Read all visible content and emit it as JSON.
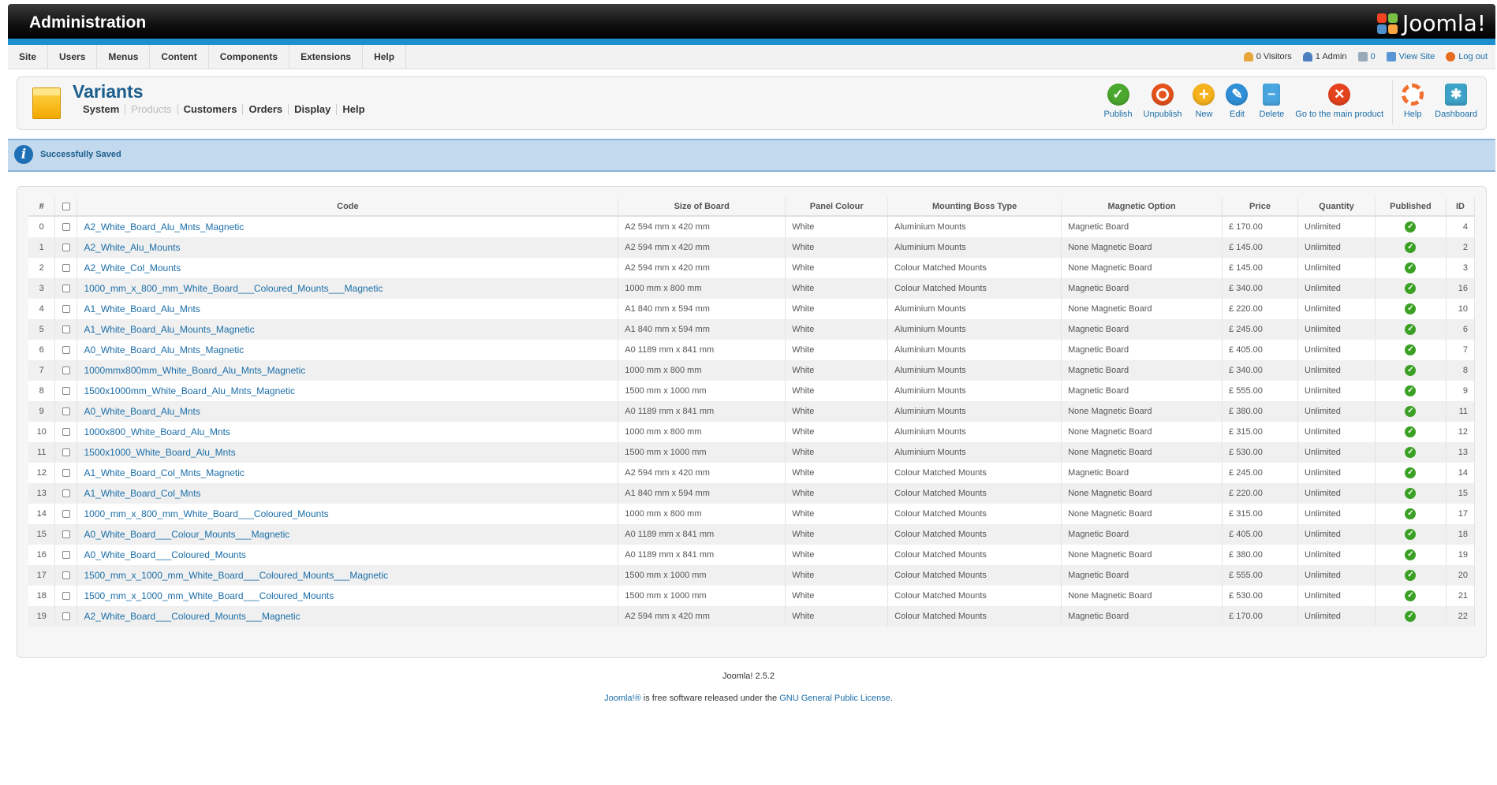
{
  "header": {
    "title": "Administration",
    "brand": "Joomla!"
  },
  "menu": [
    {
      "label": "Site"
    },
    {
      "label": "Users"
    },
    {
      "label": "Menus"
    },
    {
      "label": "Content"
    },
    {
      "label": "Components"
    },
    {
      "label": "Extensions"
    },
    {
      "label": "Help"
    }
  ],
  "status": {
    "visitors": "0 Visitors",
    "admins": "1 Admin",
    "messages": "0",
    "view_site": "View Site",
    "logout": "Log out"
  },
  "component": {
    "title": "Variants",
    "subnav": [
      {
        "label": "System",
        "enabled": true
      },
      {
        "label": "Products",
        "enabled": false
      },
      {
        "label": "Customers",
        "enabled": true
      },
      {
        "label": "Orders",
        "enabled": true
      },
      {
        "label": "Display",
        "enabled": true
      },
      {
        "label": "Help",
        "enabled": true
      }
    ]
  },
  "toolbar": {
    "publish": "Publish",
    "unpublish": "Unpublish",
    "new": "New",
    "edit": "Edit",
    "delete": "Delete",
    "goto_main": "Go to the main product",
    "help": "Help",
    "dashboard": "Dashboard"
  },
  "message": "Successfully Saved",
  "table": {
    "headers": {
      "num": "#",
      "code": "Code",
      "size": "Size of Board",
      "colour": "Panel Colour",
      "mounting": "Mounting Boss Type",
      "magnetic": "Magnetic Option",
      "price": "Price",
      "quantity": "Quantity",
      "published": "Published",
      "id": "ID"
    },
    "rows": [
      {
        "num": "0",
        "code": "A2_White_Board_Alu_Mnts_Magnetic",
        "size": "A2 594 mm x 420 mm",
        "colour": "White",
        "mounting": "Aluminium Mounts",
        "magnetic": "Magnetic Board",
        "price": "£ 170.00",
        "quantity": "Unlimited",
        "id": "4"
      },
      {
        "num": "1",
        "code": "A2_White_Alu_Mounts",
        "size": "A2 594 mm x 420 mm",
        "colour": "White",
        "mounting": "Aluminium Mounts",
        "magnetic": "None Magnetic Board",
        "price": "£ 145.00",
        "quantity": "Unlimited",
        "id": "2"
      },
      {
        "num": "2",
        "code": "A2_White_Col_Mounts",
        "size": "A2 594 mm x 420 mm",
        "colour": "White",
        "mounting": "Colour Matched Mounts",
        "magnetic": "None Magnetic Board",
        "price": "£ 145.00",
        "quantity": "Unlimited",
        "id": "3"
      },
      {
        "num": "3",
        "code": "1000_mm_x_800_mm_White_Board___Coloured_Mounts___Magnetic",
        "size": "1000 mm x 800 mm",
        "colour": "White",
        "mounting": "Colour Matched Mounts",
        "magnetic": "Magnetic Board",
        "price": "£ 340.00",
        "quantity": "Unlimited",
        "id": "16"
      },
      {
        "num": "4",
        "code": "A1_White_Board_Alu_Mnts",
        "size": "A1 840 mm x 594 mm",
        "colour": "White",
        "mounting": "Aluminium Mounts",
        "magnetic": "None Magnetic Board",
        "price": "£ 220.00",
        "quantity": "Unlimited",
        "id": "10"
      },
      {
        "num": "5",
        "code": "A1_White_Board_Alu_Mounts_Magnetic",
        "size": "A1 840 mm x 594 mm",
        "colour": "White",
        "mounting": "Aluminium Mounts",
        "magnetic": "Magnetic Board",
        "price": "£ 245.00",
        "quantity": "Unlimited",
        "id": "6"
      },
      {
        "num": "6",
        "code": "A0_White_Board_Alu_Mnts_Magnetic",
        "size": "A0 1189 mm x 841 mm",
        "colour": "White",
        "mounting": "Aluminium Mounts",
        "magnetic": "Magnetic Board",
        "price": "£ 405.00",
        "quantity": "Unlimited",
        "id": "7"
      },
      {
        "num": "7",
        "code": "1000mmx800mm_White_Board_Alu_Mnts_Magnetic",
        "size": "1000 mm x 800 mm",
        "colour": "White",
        "mounting": "Aluminium Mounts",
        "magnetic": "Magnetic Board",
        "price": "£ 340.00",
        "quantity": "Unlimited",
        "id": "8"
      },
      {
        "num": "8",
        "code": "1500x1000mm_White_Board_Alu_Mnts_Magnetic",
        "size": "1500 mm x 1000 mm",
        "colour": "White",
        "mounting": "Aluminium Mounts",
        "magnetic": "Magnetic Board",
        "price": "£ 555.00",
        "quantity": "Unlimited",
        "id": "9"
      },
      {
        "num": "9",
        "code": "A0_White_Board_Alu_Mnts",
        "size": "A0 1189 mm x 841 mm",
        "colour": "White",
        "mounting": "Aluminium Mounts",
        "magnetic": "None Magnetic Board",
        "price": "£ 380.00",
        "quantity": "Unlimited",
        "id": "11"
      },
      {
        "num": "10",
        "code": "1000x800_White_Board_Alu_Mnts",
        "size": "1000 mm x 800 mm",
        "colour": "White",
        "mounting": "Aluminium Mounts",
        "magnetic": "None Magnetic Board",
        "price": "£ 315.00",
        "quantity": "Unlimited",
        "id": "12"
      },
      {
        "num": "11",
        "code": "1500x1000_White_Board_Alu_Mnts",
        "size": "1500 mm x 1000 mm",
        "colour": "White",
        "mounting": "Aluminium Mounts",
        "magnetic": "None Magnetic Board",
        "price": "£ 530.00",
        "quantity": "Unlimited",
        "id": "13"
      },
      {
        "num": "12",
        "code": "A1_White_Board_Col_Mnts_Magnetic",
        "size": "A2 594 mm x 420 mm",
        "colour": "White",
        "mounting": "Colour Matched Mounts",
        "magnetic": "Magnetic Board",
        "price": "£ 245.00",
        "quantity": "Unlimited",
        "id": "14"
      },
      {
        "num": "13",
        "code": "A1_White_Board_Col_Mnts",
        "size": "A1 840 mm x 594 mm",
        "colour": "White",
        "mounting": "Colour Matched Mounts",
        "magnetic": "None Magnetic Board",
        "price": "£ 220.00",
        "quantity": "Unlimited",
        "id": "15"
      },
      {
        "num": "14",
        "code": "1000_mm_x_800_mm_White_Board___Coloured_Mounts",
        "size": "1000 mm x 800 mm",
        "colour": "White",
        "mounting": "Colour Matched Mounts",
        "magnetic": "None Magnetic Board",
        "price": "£ 315.00",
        "quantity": "Unlimited",
        "id": "17"
      },
      {
        "num": "15",
        "code": "A0_White_Board___Colour_Mounts___Magnetic",
        "size": "A0 1189 mm x 841 mm",
        "colour": "White",
        "mounting": "Colour Matched Mounts",
        "magnetic": "Magnetic Board",
        "price": "£ 405.00",
        "quantity": "Unlimited",
        "id": "18"
      },
      {
        "num": "16",
        "code": "A0_White_Board___Coloured_Mounts",
        "size": "A0 1189 mm x 841 mm",
        "colour": "White",
        "mounting": "Colour Matched Mounts",
        "magnetic": "None Magnetic Board",
        "price": "£ 380.00",
        "quantity": "Unlimited",
        "id": "19"
      },
      {
        "num": "17",
        "code": "1500_mm_x_1000_mm_White_Board___Coloured_Mounts___Magnetic",
        "size": "1500 mm x 1000 mm",
        "colour": "White",
        "mounting": "Colour Matched Mounts",
        "magnetic": "Magnetic Board",
        "price": "£ 555.00",
        "quantity": "Unlimited",
        "id": "20"
      },
      {
        "num": "18",
        "code": "1500_mm_x_1000_mm_White_Board___Coloured_Mounts",
        "size": "1500 mm x 1000 mm",
        "colour": "White",
        "mounting": "Colour Matched Mounts",
        "magnetic": "None Magnetic Board",
        "price": "£ 530.00",
        "quantity": "Unlimited",
        "id": "21"
      },
      {
        "num": "19",
        "code": "A2_White_Board___Coloured_Mounts___Magnetic",
        "size": "A2 594 mm x 420 mm",
        "colour": "White",
        "mounting": "Colour Matched Mounts",
        "magnetic": "Magnetic Board",
        "price": "£ 170.00",
        "quantity": "Unlimited",
        "id": "22"
      }
    ]
  },
  "footer": {
    "version": "Joomla! 2.5.2",
    "brand_link": "Joomla!®",
    "license_text": " is free software released under the ",
    "license_link": "GNU General Public License",
    "period": "."
  },
  "colors": {
    "accent": "#1e8fcf",
    "link": "#1b6ea8",
    "published": "#3ba124"
  }
}
